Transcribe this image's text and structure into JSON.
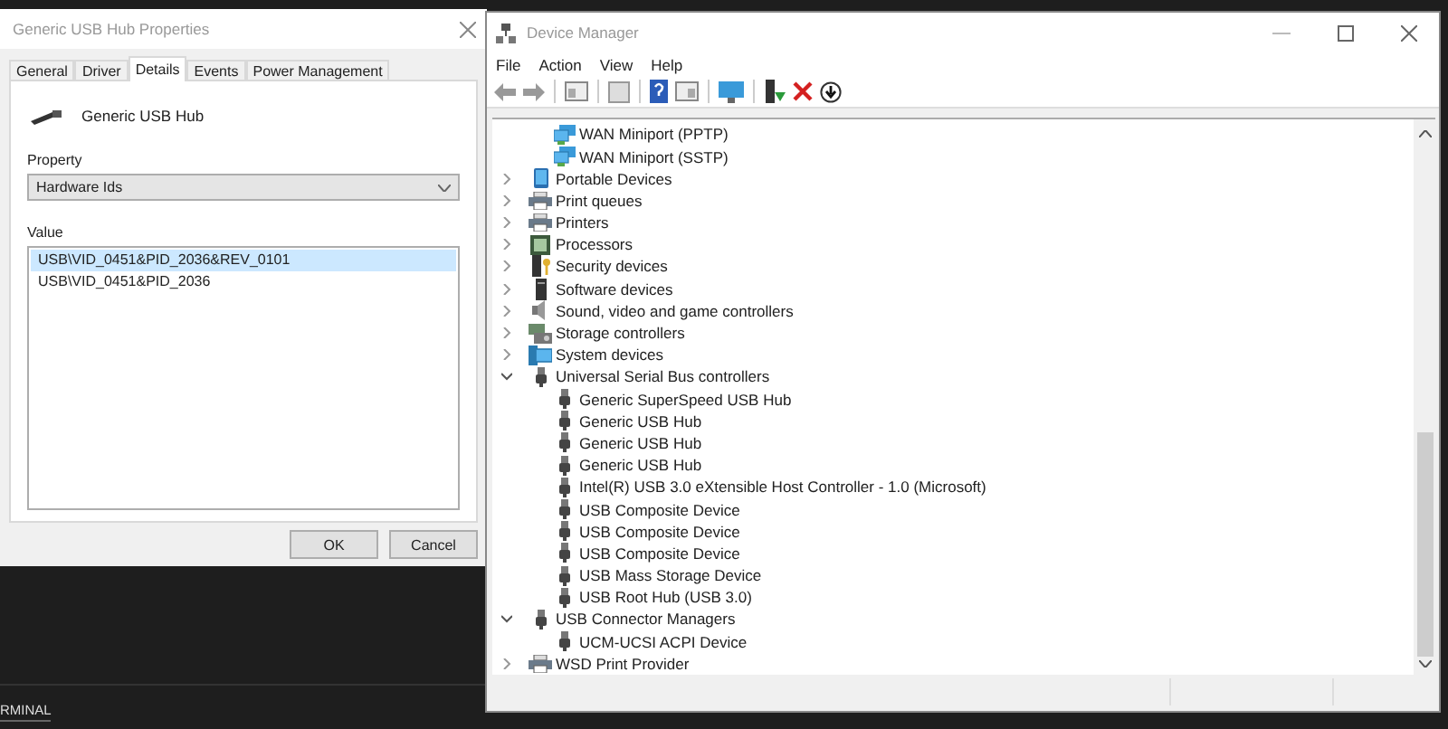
{
  "properties_dialog": {
    "title": "Generic USB Hub Properties",
    "tabs": [
      {
        "label": "General",
        "selected": false
      },
      {
        "label": "Driver",
        "selected": false
      },
      {
        "label": "Details",
        "selected": true
      },
      {
        "label": "Events",
        "selected": false
      },
      {
        "label": "Power Management",
        "selected": false
      }
    ],
    "device_name": "Generic USB Hub",
    "property": {
      "label": "Property",
      "value": "Hardware Ids"
    },
    "value": {
      "label": "Value",
      "items": [
        {
          "text": "USB\\VID_0451&PID_2036&REV_0101",
          "selected": true
        },
        {
          "text": "USB\\VID_0451&PID_2036",
          "selected": false
        }
      ]
    },
    "buttons": [
      "OK",
      "Cancel"
    ]
  },
  "device_manager": {
    "title": "Device Manager",
    "menu": [
      "File",
      "Action",
      "View",
      "Help"
    ],
    "tree_continued": [
      {
        "label": "WAN Miniport (PPTP)",
        "kind": "network"
      },
      {
        "label": "WAN Miniport (SSTP)",
        "kind": "network"
      }
    ],
    "tree": [
      {
        "label": "Portable Devices",
        "kind": "portable",
        "expanded": false
      },
      {
        "label": "Print queues",
        "kind": "printer",
        "expanded": false
      },
      {
        "label": "Printers",
        "kind": "printer",
        "expanded": false
      },
      {
        "label": "Processors",
        "kind": "processor",
        "expanded": false
      },
      {
        "label": "Security devices",
        "kind": "security",
        "expanded": false
      },
      {
        "label": "Software devices",
        "kind": "software",
        "expanded": false
      },
      {
        "label": "Sound, video and game controllers",
        "kind": "sound",
        "expanded": false
      },
      {
        "label": "Storage controllers",
        "kind": "storage",
        "expanded": false
      },
      {
        "label": "System devices",
        "kind": "system",
        "expanded": false
      },
      {
        "label": "Universal Serial Bus controllers",
        "kind": "usb",
        "expanded": true,
        "children": [
          {
            "label": "Generic SuperSpeed USB Hub",
            "kind": "usb"
          },
          {
            "label": "Generic USB Hub",
            "kind": "usb"
          },
          {
            "label": "Generic USB Hub",
            "kind": "usb"
          },
          {
            "label": "Generic USB Hub",
            "kind": "usb"
          },
          {
            "label": "Intel(R) USB 3.0 eXtensible Host Controller - 1.0 (Microsoft)",
            "kind": "usb"
          },
          {
            "label": "USB Composite Device",
            "kind": "usb"
          },
          {
            "label": "USB Composite Device",
            "kind": "usb"
          },
          {
            "label": "USB Composite Device",
            "kind": "usb"
          },
          {
            "label": "USB Mass Storage Device",
            "kind": "usb"
          },
          {
            "label": "USB Root Hub (USB 3.0)",
            "kind": "usb"
          }
        ]
      },
      {
        "label": "USB Connector Managers",
        "kind": "usb",
        "expanded": true,
        "children": [
          {
            "label": "UCM-UCSI ACPI Device",
            "kind": "usb"
          }
        ]
      },
      {
        "label": "WSD Print Provider",
        "kind": "printer",
        "expanded": false
      }
    ]
  },
  "terminal": {
    "tab": "RMINAL"
  }
}
